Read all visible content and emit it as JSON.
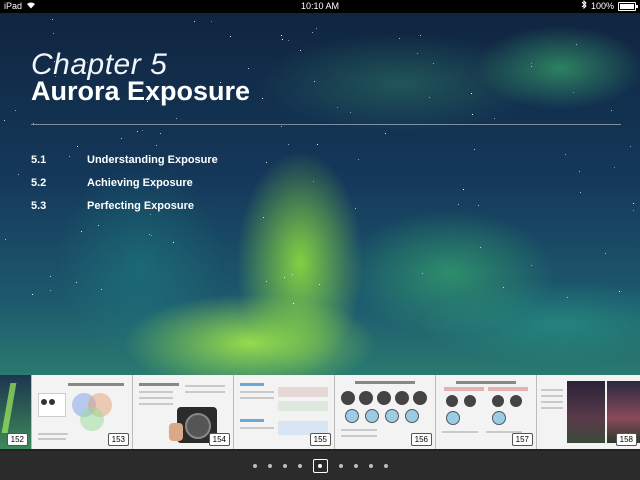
{
  "status": {
    "device": "iPad",
    "time": "10:10 AM",
    "battery": "100%",
    "battery_level": 1.0
  },
  "chapter": {
    "number": "Chapter 5",
    "title": "Aurora Exposure",
    "sections": [
      {
        "num": "5.1",
        "title": "Understanding Exposure"
      },
      {
        "num": "5.2",
        "title": "Achieving Exposure"
      },
      {
        "num": "5.3",
        "title": "Perfecting Exposure"
      }
    ]
  },
  "thumbnails": [
    "152",
    "153",
    "154",
    "155",
    "156",
    "157",
    "158"
  ],
  "pager": {
    "count": 9,
    "active_index": 4
  }
}
